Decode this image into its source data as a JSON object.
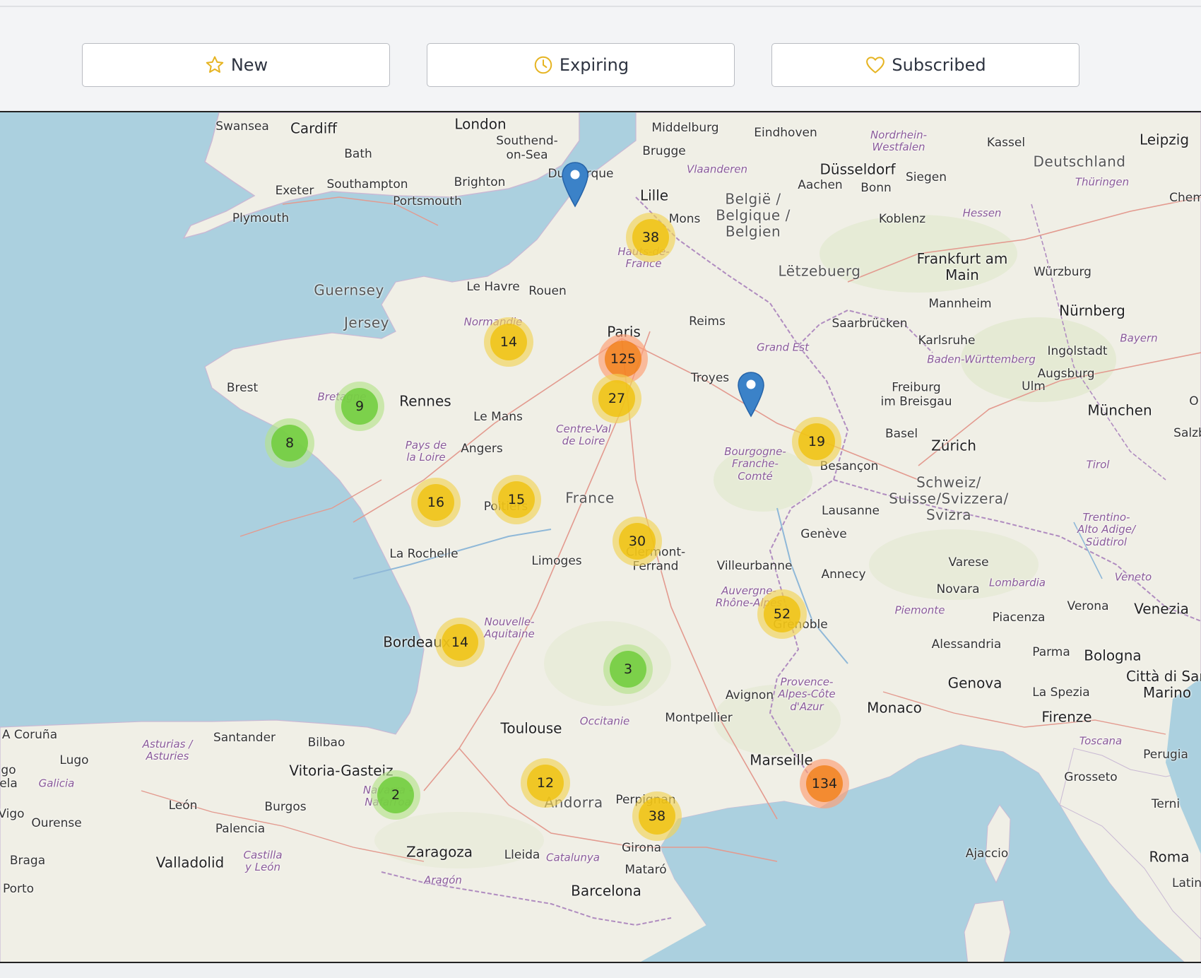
{
  "toolbar": {
    "new_label": "New",
    "expiring_label": "Expiring",
    "subscribed_label": "Subscribed",
    "icon_color": "#e6b422"
  },
  "map": {
    "places": {
      "swansea": "Swansea",
      "cardiff": "Cardiff",
      "london": "London",
      "southend": "Southend-\non-Sea",
      "bath": "Bath",
      "exeter": "Exeter",
      "southampton": "Southampton",
      "brighton": "Brighton",
      "portsmouth": "Portsmouth",
      "plymouth": "Plymouth",
      "guernsey": "Guernsey",
      "jersey": "Jersey",
      "middelburg": "Middelburg",
      "eindhoven": "Eindhoven",
      "brugge": "Brugge",
      "vlaanderen": "Vlaanderen",
      "nrw": "Nordrhein-\nWestfalen",
      "kassel": "Kassel",
      "leipzig": "Leipzig",
      "deutschland": "Deutschland",
      "thuringen": "Thüringen",
      "chem": "Chem",
      "dusseldorf": "Düsseldorf",
      "siegen": "Siegen",
      "aachen": "Aachen",
      "bonn": "Bonn",
      "dunkerque": "Dunkerque",
      "lille": "Lille",
      "mons": "Mons",
      "belgie": "België /\nBelgique /\nBelgien",
      "koblenz": "Koblenz",
      "hessen": "Hessen",
      "frankfurt": "Frankfurt am\nMain",
      "wurzburg": "Würzburg",
      "letzebuerg": "Lëtzebuerg",
      "hauts": "Hauts-de-\nFrance",
      "lehavre": "Le Havre",
      "rouen": "Rouen",
      "normandie": "Normandie",
      "paris": "Paris",
      "reims": "Reims",
      "mannheim": "Mannheim",
      "nurnberg": "Nürnberg",
      "saarbrucken": "Saarbrücken",
      "karlsruhe": "Karlsruhe",
      "bayern": "Bayern",
      "grandest": "Grand Est",
      "badenw": "Baden-Württemberg",
      "ingolstadt": "Ingolstadt",
      "augsburg": "Augsburg",
      "brest": "Brest",
      "bretagne": "Bretagne",
      "rennes": "Rennes",
      "troyes": "Troyes",
      "freiburg": "Freiburg\nim Breisgau",
      "ulm": "Ulm",
      "munchen": "München",
      "salzb": "Salzb",
      "lemans": "Le Mans",
      "cvl": "Centre-Val\nde Loire",
      "basel": "Basel",
      "zurich": "Zürich",
      "pdl": "Pays de\nla Loire",
      "angers": "Angers",
      "bfc": "Bourgogne-\nFranche-\nComté",
      "besancon": "Besançon",
      "tirol": "Tirol",
      "schweiz": "Schweiz/\nSuisse/Svizzera/\nSvizra",
      "france": "France",
      "poitiers": "Poitiers",
      "lausanne": "Lausanne",
      "trentino": "Trentino-\nAlto Adige/\nSüdtirol",
      "geneve": "Genève",
      "larochelle": "La Rochelle",
      "limoges": "Limoges",
      "clermont": "Clermont-\nFerrand",
      "villeurbanne": "Villeurbanne",
      "annecy": "Annecy",
      "varese": "Varese",
      "veneto": "Veneto",
      "aura": "Auvergne-\nRhône-Alpes",
      "lombardia": "Lombardia",
      "novara": "Novara",
      "verona": "Verona",
      "venezia": "Venezia",
      "piemonte": "Piemonte",
      "piacenza": "Piacenza",
      "grenoble": "Grenoble",
      "nouvelle": "Nouvelle-\nAquitaine",
      "bordeaux": "Bordeaux",
      "alessandria": "Alessandria",
      "parma": "Parma",
      "bologna": "Bologna",
      "provence": "Provence-\nAlpes-Côte\nd'Azur",
      "genova": "Genova",
      "cittadisan": "Città di San\nMarino",
      "avignon": "Avignon",
      "laspezia": "La Spezia",
      "monaco": "Monaco",
      "acoruna": "A Coruña",
      "santander": "Santander",
      "bilbao": "Bilbao",
      "asturias": "Asturias /\nAsturies",
      "toulouse": "Toulouse",
      "occitanie": "Occitanie",
      "montpellier": "Montpellier",
      "firenze": "Firenze",
      "lugo": "Lugo",
      "galicia": "Galicia",
      "vitoria": "Vitoria-Gasteiz",
      "marseille": "Marseille",
      "toscana": "Toscana",
      "perugia": "Perugia",
      "go": "go",
      "ela": "ela",
      "navarra": "Navarra -\nNafarroa",
      "grosseto": "Grosseto",
      "leon": "León",
      "burgos": "Burgos",
      "andorra": "Andorra",
      "perpignan": "Perpignan",
      "vigo": "Vigo",
      "ourense": "Ourense",
      "palencia": "Palencia",
      "terni": "Terni",
      "zaragoza": "Zaragoza",
      "girona": "Girona",
      "braga": "Braga",
      "valladolid": "Valladolid",
      "castilla": "Castilla\ny León",
      "lleida": "Lleida",
      "catalunya": "Catalunya",
      "ajaccio": "Ajaccio",
      "roma": "Roma",
      "mataro": "Mataró",
      "aragon": "Aragón",
      "porto": "Porto",
      "barcelona": "Barcelona",
      "latin": "Latin",
      "o": "O"
    },
    "clusters": [
      {
        "count": "38",
        "size": "medium"
      },
      {
        "count": "14",
        "size": "medium"
      },
      {
        "count": "125",
        "size": "large"
      },
      {
        "count": "27",
        "size": "medium"
      },
      {
        "count": "9",
        "size": "small"
      },
      {
        "count": "8",
        "size": "small"
      },
      {
        "count": "19",
        "size": "medium"
      },
      {
        "count": "16",
        "size": "medium"
      },
      {
        "count": "15",
        "size": "medium"
      },
      {
        "count": "30",
        "size": "medium"
      },
      {
        "count": "52",
        "size": "medium"
      },
      {
        "count": "14",
        "size": "medium"
      },
      {
        "count": "3",
        "size": "small"
      },
      {
        "count": "2",
        "size": "small"
      },
      {
        "count": "12",
        "size": "medium"
      },
      {
        "count": "38",
        "size": "medium"
      },
      {
        "count": "134",
        "size": "large"
      }
    ],
    "colors": {
      "sea": "#abd0df",
      "land": "#f0efe6",
      "marker": "#3b82c8",
      "cluster_small": "#6ecc39",
      "cluster_medium": "#f0c20c",
      "cluster_large": "#f18017"
    }
  }
}
